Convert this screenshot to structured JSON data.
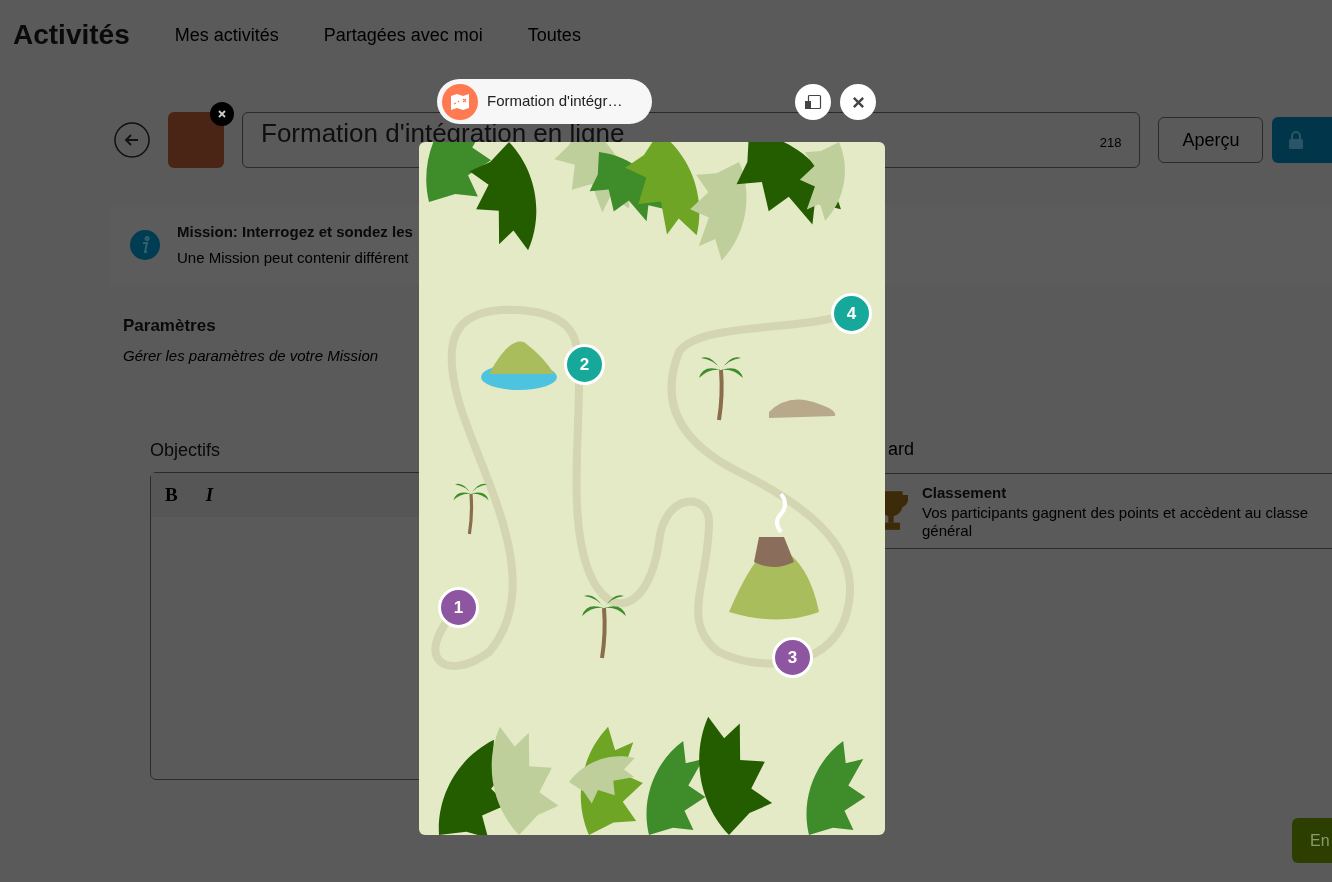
{
  "app_title": "Activités",
  "nav_tabs": [
    {
      "label": "Mes activités"
    },
    {
      "label": "Partagées avec moi"
    },
    {
      "label": "Toutes"
    }
  ],
  "activity": {
    "title": "Formation d'intégration en ligne",
    "char_count": "218",
    "preview_button": "Aperçu"
  },
  "info": {
    "title": "Mission: Interrogez et sondez les",
    "text": "Une Mission peut contenir différent"
  },
  "settings": {
    "title": "Paramètres",
    "subtitle": "Gérer les paramètres de votre Mission"
  },
  "objectives": {
    "label": "Objectifs",
    "toolbar": [
      {
        "label": "B",
        "kind": "bold"
      },
      {
        "label": "I",
        "kind": "italic"
      }
    ]
  },
  "right_section": {
    "label": "ard",
    "option": {
      "title": "Classement",
      "description": "Vos participants gagnent des points et accèdent au classe général"
    }
  },
  "bottom_button": "En",
  "preview_modal": {
    "title": "Formation d'intégr…",
    "map_markers": [
      {
        "label": "1",
        "color": "#8e55a0"
      },
      {
        "label": "2",
        "color": "#16a99a"
      },
      {
        "label": "3",
        "color": "#8e55a0"
      },
      {
        "label": "4",
        "color": "#16a99a"
      }
    ]
  }
}
